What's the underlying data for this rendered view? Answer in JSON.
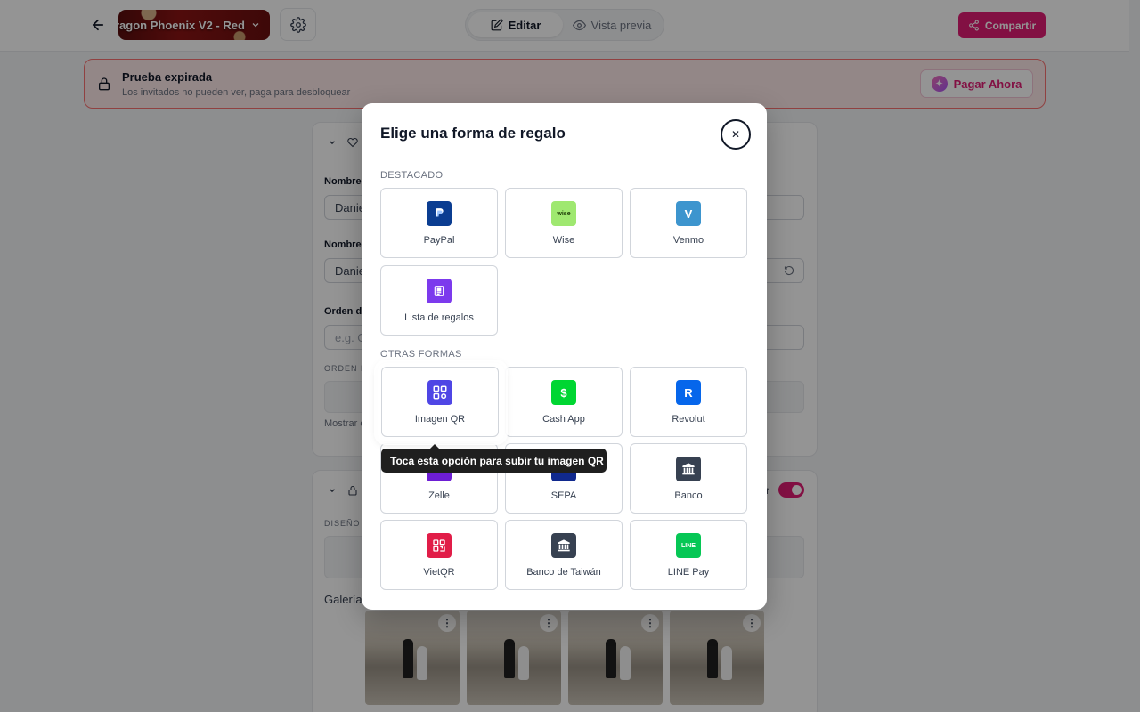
{
  "topbar": {
    "theme_name": "ragon Phoenix V2 - Red",
    "mode_edit": "Editar",
    "mode_preview": "Vista previa",
    "share": "Compartir"
  },
  "banner": {
    "title": "Prueba expirada",
    "subtitle": "Los invitados no pueden ver, paga para desbloquear",
    "pay_button": "Pagar Ahora"
  },
  "editor": {
    "label_nombre1": "Nombre",
    "value_nombre1": "Danie",
    "label_nombre2": "Nombre",
    "value_nombre2": "Danie",
    "label_orden": "Orden d",
    "placeholder_orden": "e.g. G",
    "small_orden": "ORDEN D",
    "mostrar": "Mostrar e",
    "diseno": "DISEÑO",
    "galeria": "Galería",
    "toggle_tail": "r"
  },
  "modal": {
    "title": "Elige una forma de regalo",
    "close_icon": "close-icon",
    "featured_label": "DESTACADO",
    "others_label": "OTRAS FORMAS",
    "featured": [
      {
        "label": "PayPal",
        "icon": "paypal-icon",
        "color": "#0b3d91",
        "glyph": "P"
      },
      {
        "label": "Wise",
        "icon": "wise-icon",
        "color": "#9fe870",
        "glyph": "wise"
      },
      {
        "label": "Venmo",
        "icon": "venmo-icon",
        "color": "#3d95ce",
        "glyph": "V"
      },
      {
        "label": "Lista de regalos",
        "icon": "gift-list-icon",
        "color": "#7c3aed",
        "glyph": "▤"
      }
    ],
    "others": [
      {
        "label": "Imagen QR",
        "icon": "qr-code-icon",
        "color": "#4f46e5",
        "glyph": "⊞"
      },
      {
        "label": "Cash App",
        "icon": "cash-app-icon",
        "color": "#00d632",
        "glyph": "$"
      },
      {
        "label": "Revolut",
        "icon": "revolut-icon",
        "color": "#0666eb",
        "glyph": "R"
      },
      {
        "label": "Zelle",
        "icon": "zelle-icon",
        "color": "#6d1ed4",
        "glyph": "Z"
      },
      {
        "label": "SEPA",
        "icon": "sepa-icon",
        "color": "#10298e",
        "glyph": "€"
      },
      {
        "label": "Banco",
        "icon": "bank-icon",
        "color": "#374151",
        "glyph": "🏛"
      },
      {
        "label": "VietQR",
        "icon": "vietqr-icon",
        "color": "#e11d48",
        "glyph": "⊞"
      },
      {
        "label": "Banco de Taiwán",
        "icon": "bank-taiwan-icon",
        "color": "#374151",
        "glyph": "🏛"
      },
      {
        "label": "LINE Pay",
        "icon": "line-pay-icon",
        "color": "#06c755",
        "glyph": "LINE"
      }
    ],
    "tooltip": "Toca esta opción para subir tu imagen QR"
  },
  "colors": {
    "accent": "#e11d74",
    "banner_bg": "#fde8e8",
    "banner_border": "#f87171"
  }
}
